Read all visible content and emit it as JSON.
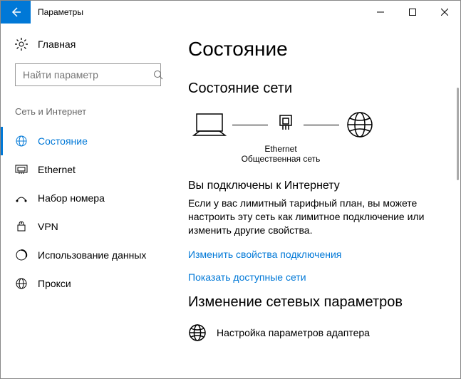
{
  "window": {
    "title": "Параметры"
  },
  "sidebar": {
    "home_label": "Главная",
    "search_placeholder": "Найти параметр",
    "group_label": "Сеть и Интернет",
    "items": [
      {
        "label": "Состояние"
      },
      {
        "label": "Ethernet"
      },
      {
        "label": "Набор номера"
      },
      {
        "label": "VPN"
      },
      {
        "label": "Использование данных"
      },
      {
        "label": "Прокси"
      }
    ]
  },
  "main": {
    "page_title": "Состояние",
    "section_title": "Состояние сети",
    "diagram": {
      "conn_label": "Ethernet",
      "conn_subtype": "Общественная сеть"
    },
    "connected_heading": "Вы подключены к Интернету",
    "connected_desc": "Если у вас лимитный тарифный план, вы можете настроить эту сеть как лимитное подключение или изменить другие свойства.",
    "link_change_props": "Изменить свойства подключения",
    "link_show_networks": "Показать доступные сети",
    "change_params_heading": "Изменение сетевых параметров",
    "adapter_label": "Настройка параметров адаптера"
  }
}
